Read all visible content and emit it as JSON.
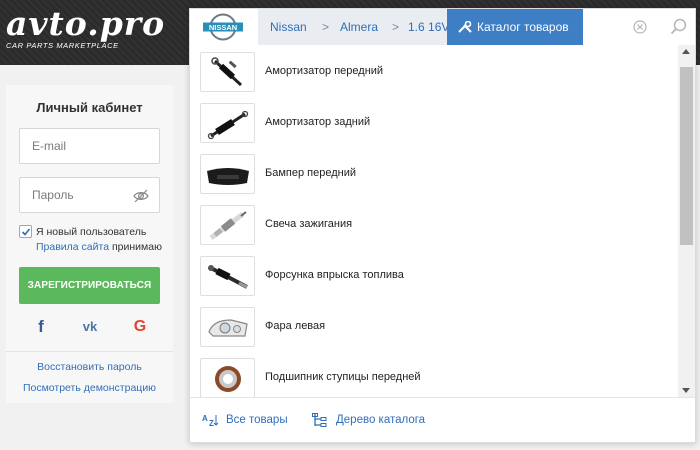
{
  "header": {
    "logo_text": "avto.pro",
    "tagline": "CAR PARTS MARKETPLACE"
  },
  "login": {
    "title": "Личный кабинет",
    "email_placeholder": "E-mail",
    "password_placeholder": "Пароль",
    "new_user_label": "Я новый пользователь",
    "site_rules_link": "Правила сайта",
    "accept_text": "принимаю",
    "register_button": "ЗАРЕГИСТРИРОВАТЬСЯ",
    "social": {
      "facebook": "f",
      "vk": "vk",
      "google": "G"
    },
    "restore_password": "Восстановить пароль",
    "view_demo": "Посмотреть демонстрацию",
    "new_user_checked": true
  },
  "catalog": {
    "brand_logo_text": "NISSAN",
    "breadcrumb": [
      "Nissan",
      "Almera",
      "1.6 16V"
    ],
    "catalog_tab": "Каталог товаров",
    "items": [
      {
        "label": "Амортизатор передний",
        "icon": "front-shock-absorber-image"
      },
      {
        "label": "Амортизатор задний",
        "icon": "rear-shock-absorber-image"
      },
      {
        "label": "Бампер передний",
        "icon": "front-bumper-image"
      },
      {
        "label": "Свеча зажигания",
        "icon": "spark-plug-image"
      },
      {
        "label": "Форсунка впрыска топлива",
        "icon": "fuel-injector-image"
      },
      {
        "label": "Фара левая",
        "icon": "left-headlight-image"
      },
      {
        "label": "Подшипник ступицы передней",
        "icon": "wheel-hub-bearing-image"
      }
    ],
    "footer": {
      "all_products": "Все товары",
      "catalog_tree": "Дерево каталога"
    },
    "colors": {
      "accent": "#3d7ec4",
      "link": "#2f6fb8",
      "register": "#5cb85c"
    }
  }
}
